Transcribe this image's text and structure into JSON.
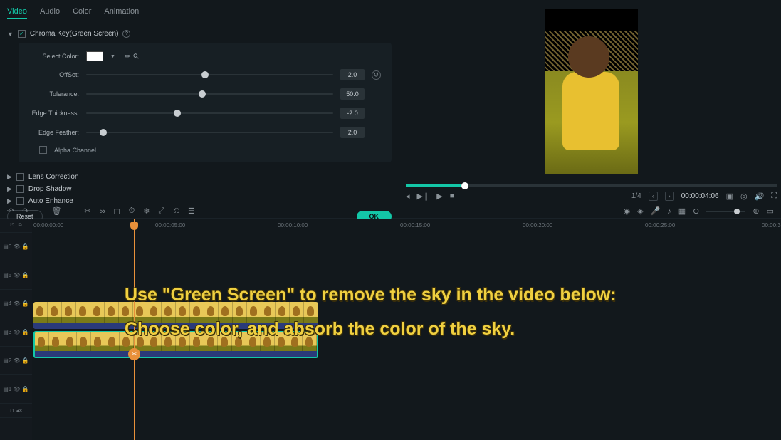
{
  "tabs": {
    "video": "Video",
    "audio": "Audio",
    "color": "Color",
    "animation": "Animation"
  },
  "chroma": {
    "title": "Chroma Key(Green Screen)",
    "select_color": "Select Color:",
    "offset_label": "OffSet:",
    "offset_value": "2.0",
    "tolerance_label": "Tolerance:",
    "tolerance_value": "50.0",
    "edge_thickness_label": "Edge Thickness:",
    "edge_thickness_value": "-2.0",
    "edge_feather_label": "Edge Feather:",
    "edge_feather_value": "2.0",
    "alpha_channel": "Alpha Channel"
  },
  "effects": {
    "lens": "Lens Correction",
    "shadow": "Drop Shadow",
    "enhance": "Auto Enhance"
  },
  "buttons": {
    "reset": "Reset",
    "ok": "OK"
  },
  "preview": {
    "zoom": "1/4",
    "timecode": "00:00:04:06"
  },
  "ruler": {
    "t0": "00:00:00:00",
    "t5": "00:00:05:00",
    "t10": "00:00:10:00",
    "t15": "00:00:15:00",
    "t20": "00:00:20:00",
    "t25": "00:00:25:00",
    "t30": "00:00:3"
  },
  "tutorial": {
    "line1": "Use \"Green Screen\" to remove the sky in the video below:",
    "line2": "Choose color, and absorb the color of the sky."
  }
}
